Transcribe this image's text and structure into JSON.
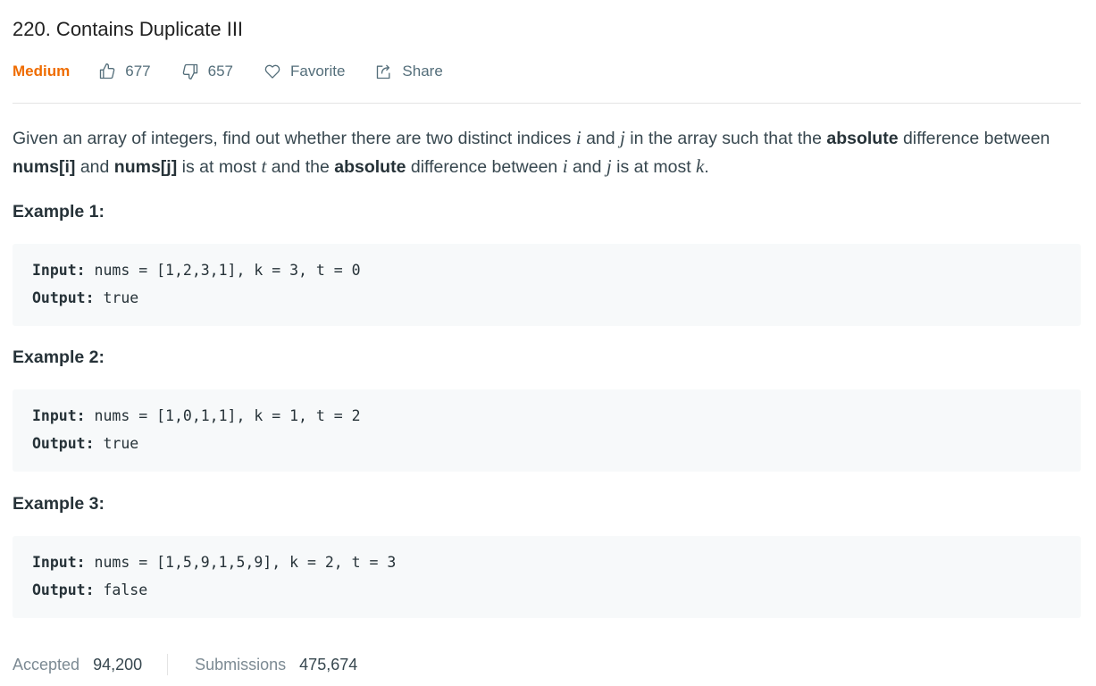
{
  "problem": {
    "title": "220. Contains Duplicate III",
    "difficulty": "Medium",
    "likes": "677",
    "dislikes": "657",
    "favorite_label": "Favorite",
    "share_label": "Share",
    "accent_color": "#ef6c00"
  },
  "description": {
    "t1": "Given an array of integers, find out whether there are two distinct indices ",
    "i": "i",
    "t2": " and ",
    "j": "j",
    "t3": " in the array such that the ",
    "absolute1": "absolute",
    "t4": " difference between ",
    "nums_i": "nums[i]",
    "t5": " and ",
    "nums_j": "nums[j]",
    "t6": " is at most ",
    "t_var": "t",
    "t7": " and the ",
    "absolute2": "absolute",
    "t8": " difference between ",
    "i2": "i",
    "t9": " and ",
    "j2": "j",
    "t10": " is at most ",
    "k_var": "k",
    "t11": "."
  },
  "examples": [
    {
      "label": "Example 1:",
      "input_label": "Input:",
      "input": " nums = [1,2,3,1], k = 3, t = 0",
      "output_label": "Output:",
      "output": " true"
    },
    {
      "label": "Example 2:",
      "input_label": "Input:",
      "input": " nums = [1,0,1,1], k = 1, t = 2",
      "output_label": "Output:",
      "output": " true"
    },
    {
      "label": "Example 3:",
      "input_label": "Input:",
      "input": " nums = [1,5,9,1,5,9], k = 2, t = 3",
      "output_label": "Output:",
      "output": " false"
    }
  ],
  "stats": {
    "accepted_label": "Accepted",
    "accepted_value": "94,200",
    "submissions_label": "Submissions",
    "submissions_value": "475,674"
  }
}
